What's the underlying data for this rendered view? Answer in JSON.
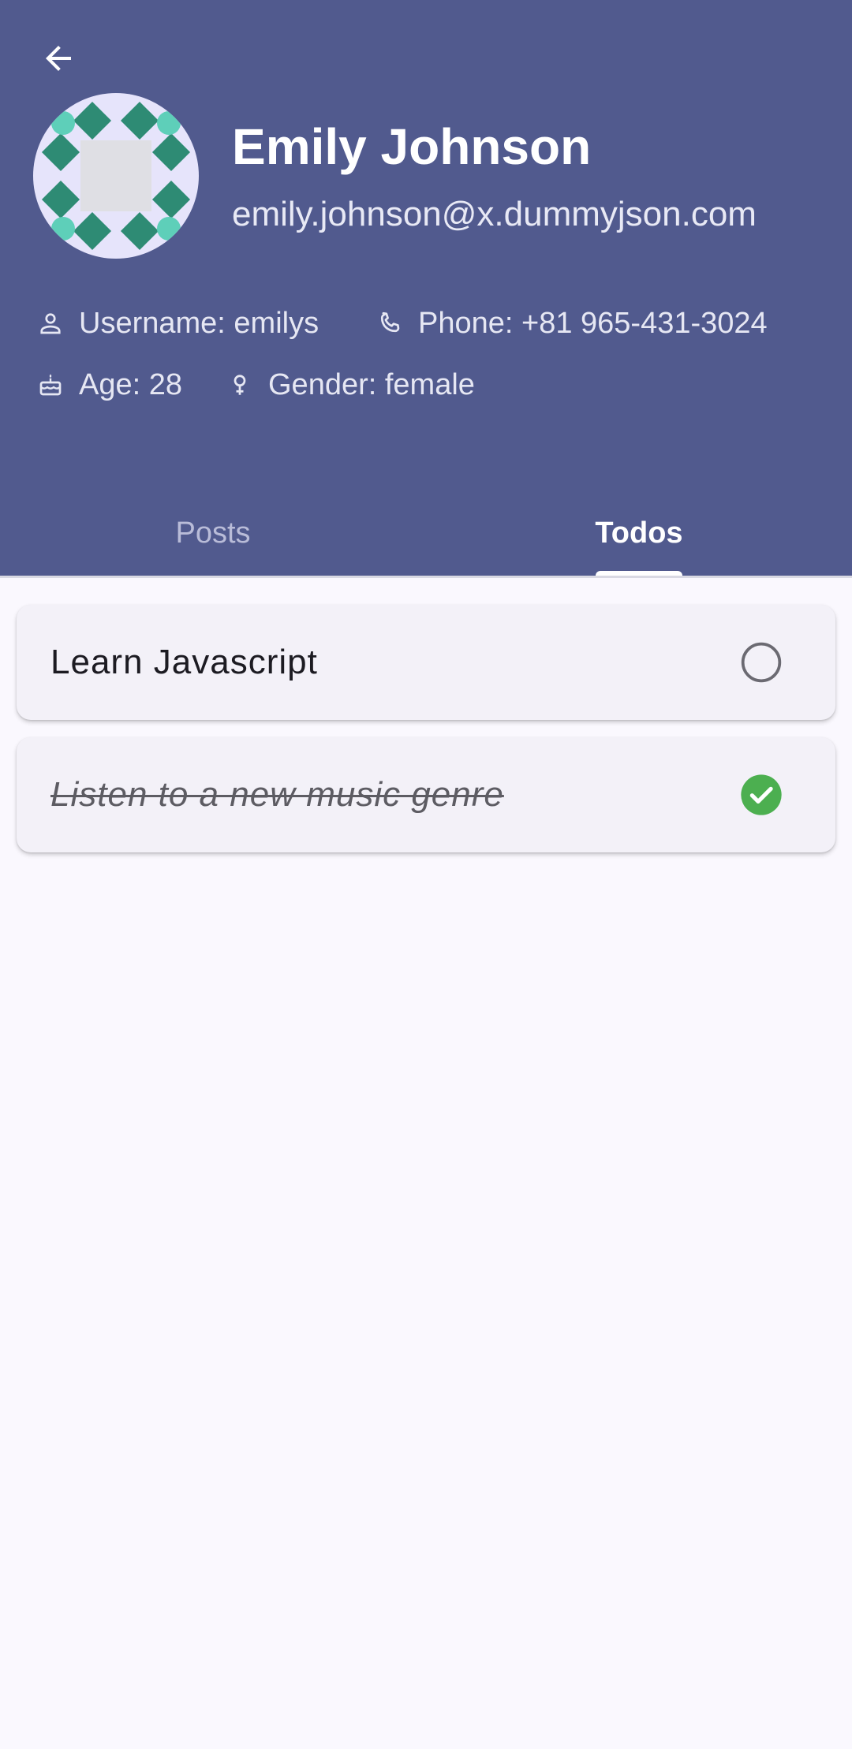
{
  "header": {
    "back_icon": "arrow-back-icon",
    "name": "Emily Johnson",
    "email": "emily.johnson@x.dummyjson.com",
    "info": {
      "username": "Username: emilys",
      "phone": "Phone: +81 965-431-3024",
      "age": "Age: 28",
      "gender": "Gender: female"
    }
  },
  "tabs": [
    {
      "label": "Posts",
      "selected": false
    },
    {
      "label": "Todos",
      "selected": true
    }
  ],
  "todos": [
    {
      "title": "Learn Javascript",
      "completed": false
    },
    {
      "title": "Listen to a new music genre",
      "completed": true
    }
  ],
  "colors": {
    "header_bg": "#515A8E",
    "page_bg": "#FAF8FE",
    "card_bg": "#F3F1F8",
    "check_green": "#4CAF50"
  }
}
